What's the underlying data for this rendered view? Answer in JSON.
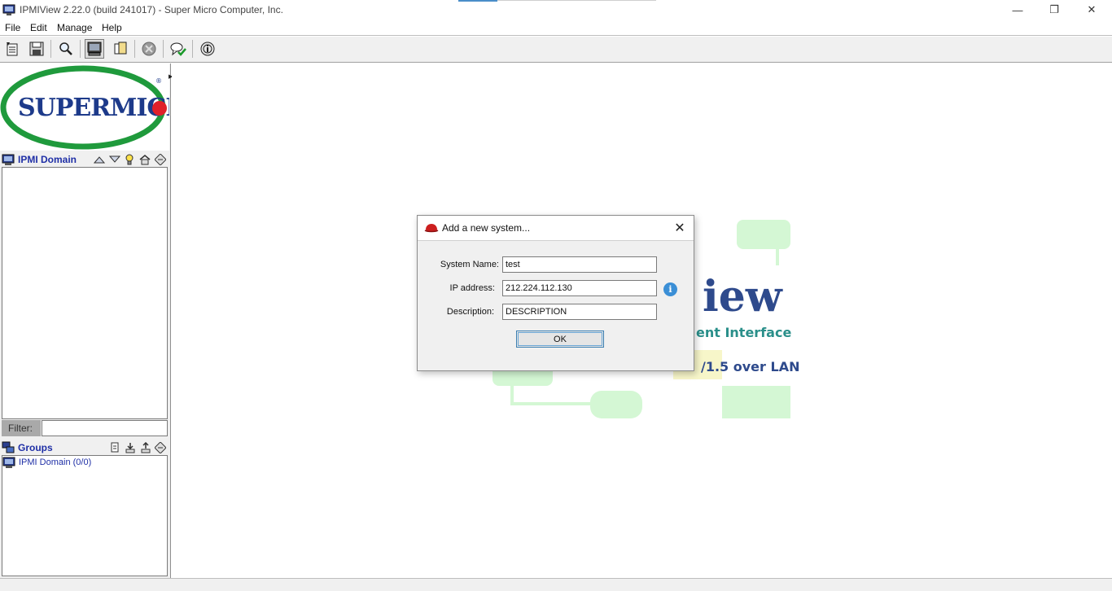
{
  "window": {
    "title": "IPMIView 2.22.0 (build 241017) - Super Micro Computer, Inc.",
    "minimize_glyph": "—",
    "restore_glyph": "❐",
    "close_glyph": "✕"
  },
  "menubar": {
    "items": [
      {
        "label": "File"
      },
      {
        "label": "Edit"
      },
      {
        "label": "Manage"
      },
      {
        "label": "Help"
      }
    ]
  },
  "toolbar": {
    "buttons": [
      {
        "icon": "new-icon"
      },
      {
        "icon": "save-icon"
      },
      {
        "icon": "search-icon"
      },
      {
        "icon": "monitor-icon",
        "pressed": true
      },
      {
        "icon": "copy-icon"
      },
      {
        "icon": "stop-icon"
      },
      {
        "icon": "chat-check-icon"
      },
      {
        "icon": "about-icon"
      }
    ]
  },
  "logo": {
    "brand": "SUPERMICR",
    "registered": "®",
    "colors": {
      "ring": "#1f9a3c",
      "text": "#1d3a8a",
      "dot": "#e0202a"
    }
  },
  "domain_panel": {
    "title": "IPMI Domain",
    "filter_label": "Filter:",
    "filter_value": ""
  },
  "groups_panel": {
    "title": "Groups",
    "nodes": [
      {
        "label": "IPMI Domain (0/0)"
      }
    ]
  },
  "splash": {
    "big_text": "iew",
    "subtitle": "ent Interface",
    "lan_text": "/1.5 over LAN",
    "colors": {
      "blob": "#d4f7d4",
      "title": "#2e4a8c",
      "subtitle": "#2a8f8a"
    }
  },
  "dialog": {
    "title": "Add a new system...",
    "fields": {
      "system_name": {
        "label": "System Name:",
        "value": "test"
      },
      "ip_address": {
        "label": "IP address:",
        "value": "212.224.112.130"
      },
      "description": {
        "label": "Description:",
        "value": "DESCRIPTION"
      }
    },
    "info_glyph": "i",
    "ok_label": "OK",
    "close_glyph": "✕"
  }
}
